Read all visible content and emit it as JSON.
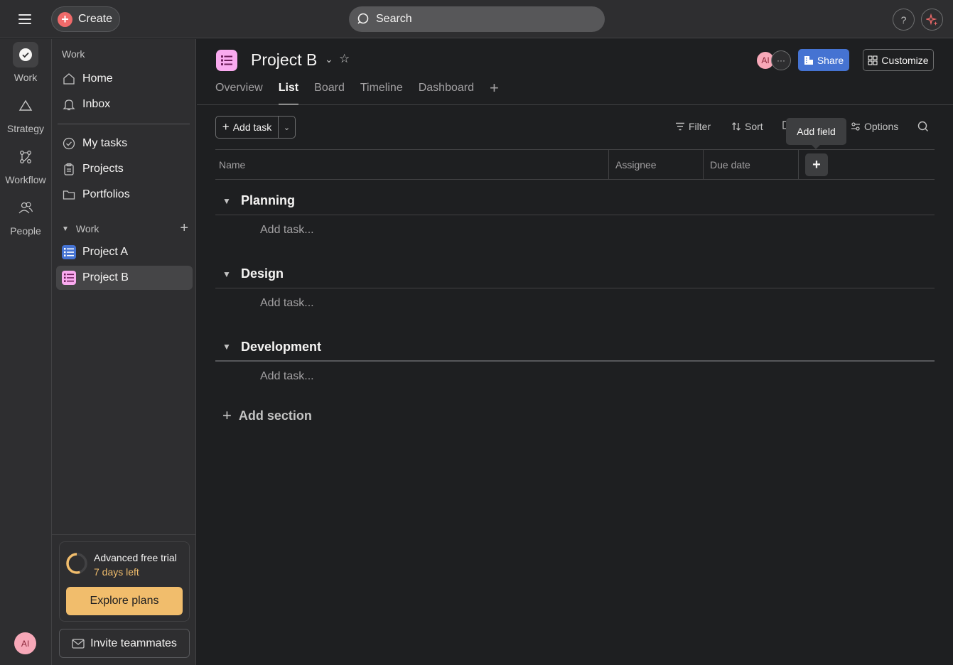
{
  "topbar": {
    "create_label": "Create",
    "search_placeholder": "Search",
    "help_label": "?"
  },
  "rail": {
    "items": [
      {
        "label": "Work",
        "icon": "check-circle-icon"
      },
      {
        "label": "Strategy",
        "icon": "triangle-icon"
      },
      {
        "label": "Workflow",
        "icon": "workflow-icon"
      },
      {
        "label": "People",
        "icon": "people-icon"
      }
    ],
    "avatar": "AI"
  },
  "sidebar": {
    "heading": "Work",
    "nav": [
      {
        "label": "Home",
        "icon": "home-icon"
      },
      {
        "label": "Inbox",
        "icon": "bell-icon"
      }
    ],
    "nav2": [
      {
        "label": "My tasks",
        "icon": "check-circle-icon"
      },
      {
        "label": "Projects",
        "icon": "clipboard-icon"
      },
      {
        "label": "Portfolios",
        "icon": "folder-icon"
      }
    ],
    "work_section": "Work",
    "projects": [
      {
        "label": "Project A",
        "color": "#4573d2"
      },
      {
        "label": "Project B",
        "color": "#f9aaef"
      }
    ],
    "trial": {
      "title": "Advanced free trial",
      "days_left": "7 days left",
      "explore_label": "Explore plans"
    },
    "invite_label": "Invite teammates"
  },
  "project": {
    "title": "Project B",
    "avatar": "AI",
    "share_label": "Share",
    "customize_label": "Customize",
    "tabs": [
      "Overview",
      "List",
      "Board",
      "Timeline",
      "Dashboard"
    ],
    "active_tab": "List"
  },
  "toolbar": {
    "add_task_label": "Add task",
    "filter_label": "Filter",
    "sort_label": "Sort",
    "options_label": "Options",
    "tooltip": "Add field"
  },
  "table": {
    "columns": [
      "Name",
      "Assignee",
      "Due date"
    ]
  },
  "sections": [
    {
      "title": "Planning",
      "add_task": "Add task..."
    },
    {
      "title": "Design",
      "add_task": "Add task..."
    },
    {
      "title": "Development",
      "add_task": "Add task..."
    }
  ],
  "add_section_label": "Add section",
  "colors": {
    "accent_blue": "#4573d2",
    "create_red": "#f06a6a",
    "trial_orange": "#f1bd6c",
    "project_b_pink": "#f9aaef"
  }
}
